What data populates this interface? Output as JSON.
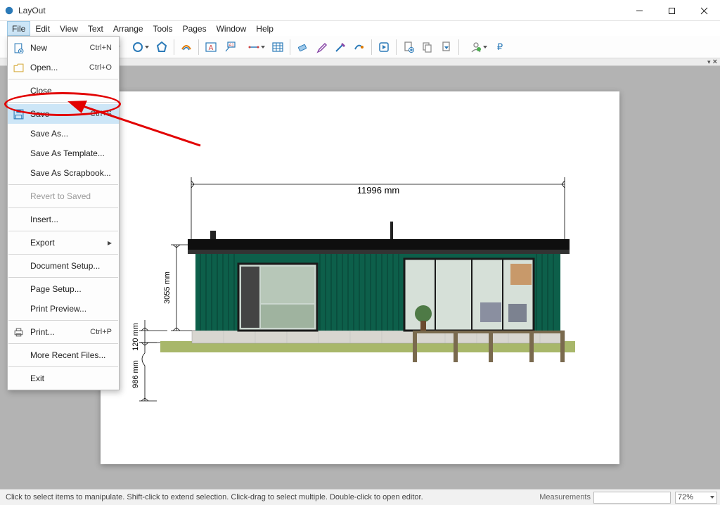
{
  "window": {
    "title": "LayOut",
    "controls": {
      "min": "–",
      "max": "☐",
      "close": "✕"
    }
  },
  "menubar": [
    "File",
    "Edit",
    "View",
    "Text",
    "Arrange",
    "Tools",
    "Pages",
    "Window",
    "Help"
  ],
  "file_menu": [
    {
      "label": "New",
      "shortcut": "Ctrl+N",
      "icon": "new-doc"
    },
    {
      "label": "Open...",
      "shortcut": "Ctrl+O",
      "icon": "folder-open"
    },
    {
      "sep": true
    },
    {
      "label": "Close"
    },
    {
      "sep": true
    },
    {
      "label": "Save",
      "shortcut": "Ctrl+S",
      "icon": "save",
      "highlight": true
    },
    {
      "label": "Save As..."
    },
    {
      "label": "Save As Template..."
    },
    {
      "label": "Save As Scrapbook..."
    },
    {
      "sep": true
    },
    {
      "label": "Revert to Saved",
      "disabled": true
    },
    {
      "sep": true
    },
    {
      "label": "Insert..."
    },
    {
      "sep": true
    },
    {
      "label": "Export",
      "submenu": true
    },
    {
      "sep": true
    },
    {
      "label": "Document Setup..."
    },
    {
      "sep": true
    },
    {
      "label": "Page Setup..."
    },
    {
      "label": "Print Preview..."
    },
    {
      "sep": true
    },
    {
      "label": "Print...",
      "shortcut": "Ctrl+P",
      "icon": "printer"
    },
    {
      "sep": true
    },
    {
      "label": "More Recent Files..."
    },
    {
      "sep": true
    },
    {
      "label": "Exit"
    }
  ],
  "statusbar": {
    "hint": "Click to select items to manipulate. Shift-click to extend selection. Click-drag to select multiple. Double-click to open editor.",
    "measurements_label": "Measurements",
    "zoom": "72%"
  },
  "drawing": {
    "dim_top": "11996 mm",
    "dim_wall": "3055 mm",
    "dim_plinth": "120 mm",
    "dim_bottom": "986 mm"
  },
  "colors": {
    "annotation": "#e20000",
    "menu_highlight": "#cde6f7",
    "accent": "#2b7ab8",
    "house_wall": "#0d5f4a"
  }
}
